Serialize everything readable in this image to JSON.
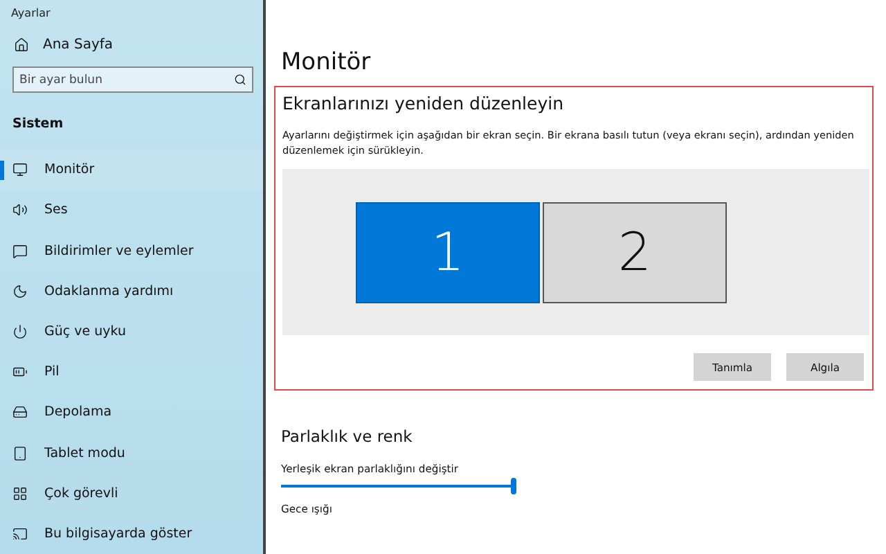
{
  "window": {
    "title": "Ayarlar"
  },
  "sidebar": {
    "home": "Ana Sayfa",
    "search": {
      "placeholder": "Bir ayar bulun"
    },
    "section": "Sistem",
    "items": [
      {
        "label": "Monitör",
        "selected": true
      },
      {
        "label": "Ses",
        "selected": false
      },
      {
        "label": "Bildirimler ve eylemler",
        "selected": false
      },
      {
        "label": "Odaklanma yardımı",
        "selected": false
      },
      {
        "label": "Güç ve uyku",
        "selected": false
      },
      {
        "label": "Pil",
        "selected": false
      },
      {
        "label": "Depolama",
        "selected": false
      },
      {
        "label": "Tablet modu",
        "selected": false
      },
      {
        "label": "Çok görevli",
        "selected": false
      },
      {
        "label": "Bu bilgisayarda göster",
        "selected": false
      }
    ]
  },
  "page": {
    "title": "Monitör",
    "arrange": {
      "heading": "Ekranlarınızı yeniden düzenleyin",
      "description": "Ayarlarını değiştirmek için aşağıdan bir ekran seçin. Bir ekrana basılı tutun (veya ekranı seçin), ardından yeniden düzenlemek için sürükleyin.",
      "displays": [
        {
          "label": "1",
          "selected": true
        },
        {
          "label": "2",
          "selected": false
        }
      ],
      "buttons": [
        "Tanımla",
        "Algıla"
      ]
    },
    "brightness": {
      "heading": "Parlaklık ve renk",
      "slider_label": "Yerleşik ekran parlaklığını değiştir",
      "level": 1,
      "night_light": "Gece ışığı"
    }
  }
}
